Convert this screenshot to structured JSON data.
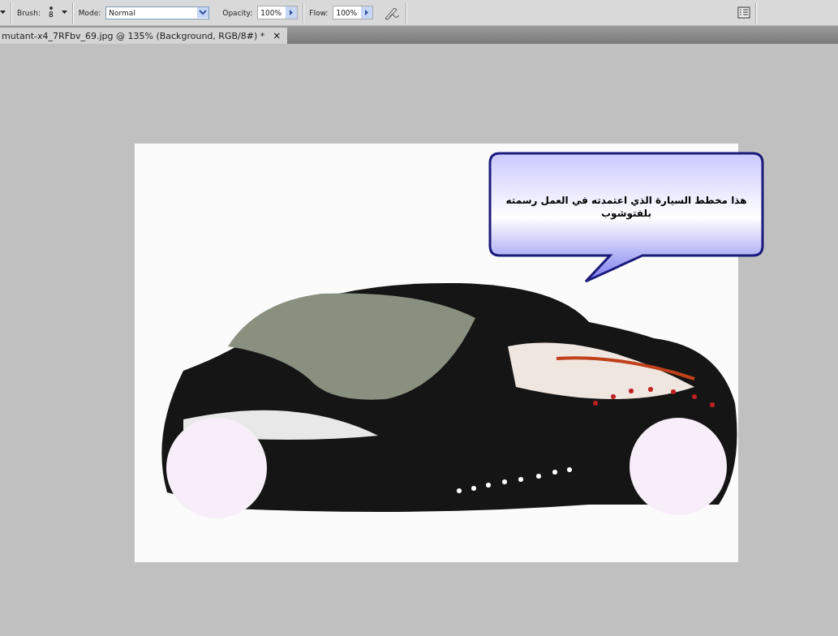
{
  "options_bar": {
    "brush_label": "Brush:",
    "brush_size": "8",
    "mode_label": "Mode:",
    "mode_value": "Normal",
    "opacity_label": "Opacity:",
    "opacity_value": "100%",
    "flow_label": "Flow:",
    "flow_value": "100%"
  },
  "document_tab": {
    "title": "mutant-x4_7RFbv_69.jpg @ 135% (Background, RGB/8#) *",
    "close": "×",
    "selected": true
  },
  "canvas": {
    "speech_bubble": {
      "text": "هذا مخطط السيارة الذي اعتمدته في العمل رسمته بلفتوشوب"
    }
  }
}
